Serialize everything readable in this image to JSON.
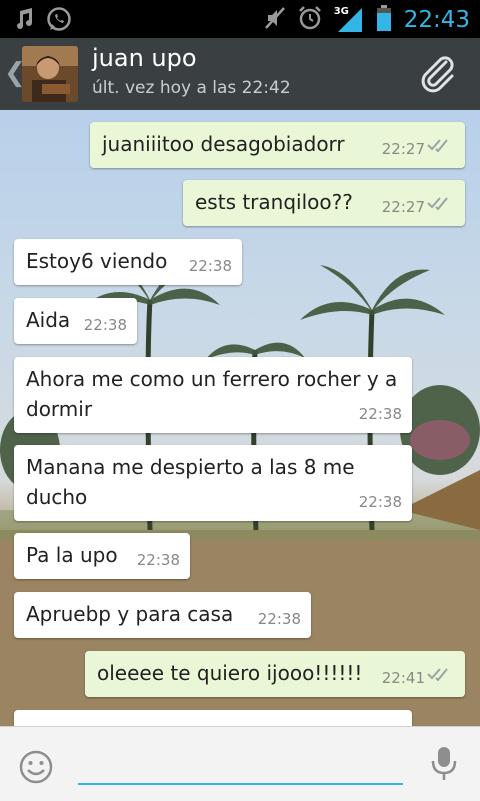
{
  "status_bar": {
    "time": "22:43",
    "network": "3G",
    "icons": [
      "music-icon",
      "whatsapp-icon",
      "mute-icon",
      "alarm-icon",
      "signal-icon",
      "battery-icon"
    ]
  },
  "header": {
    "contact_name": "juan upo",
    "last_seen": "últ. vez hoy a las 22:42"
  },
  "messages": [
    {
      "text": "juaniiitoo desagobiadorr",
      "time": "22:27",
      "direction": "out"
    },
    {
      "text": "ests tranqiloo??",
      "time": "22:27",
      "direction": "out"
    },
    {
      "text": "Estoy6 viendo",
      "time": "22:38",
      "direction": "in"
    },
    {
      "text": "Aida",
      "time": "22:38",
      "direction": "in"
    },
    {
      "text": "Ahora me como un ferrero rocher y a dormir",
      "time": "22:38",
      "direction": "in"
    },
    {
      "text": "Manana me despierto a las 8 me ducho",
      "time": "22:38",
      "direction": "in"
    },
    {
      "text": "Pa la upo",
      "time": "22:38",
      "direction": "in"
    },
    {
      "text": "Apruebp y para casa",
      "time": "22:38",
      "direction": "in"
    },
    {
      "text": "oleeee te quiero ijooo!!!!!!",
      "time": "22:41",
      "direction": "out"
    }
  ],
  "colors": {
    "accent": "#33b5e5",
    "header_bg": "#3a3f42",
    "outgoing_bubble": "#eaf7d6",
    "incoming_bubble": "#ffffff"
  }
}
